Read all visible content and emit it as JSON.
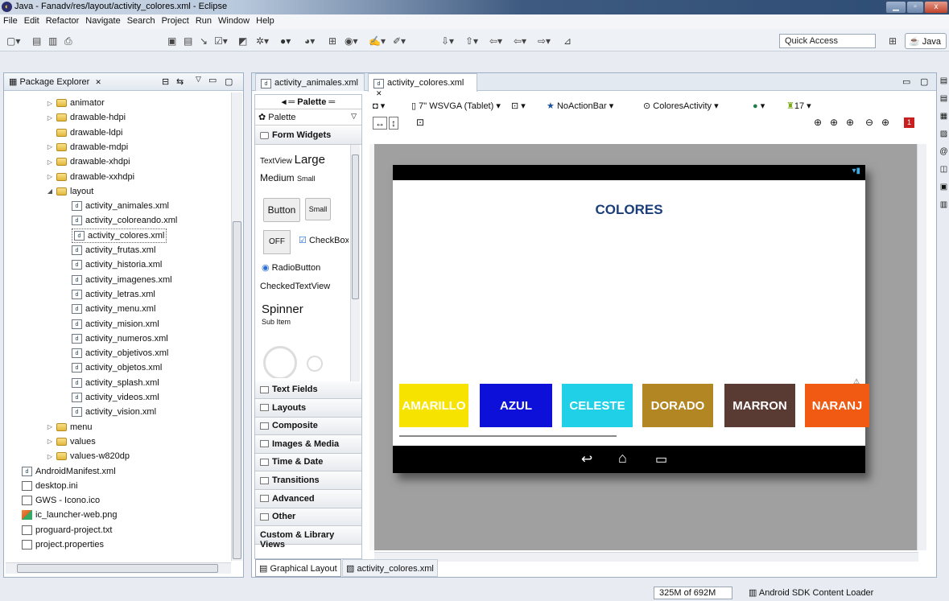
{
  "window": {
    "title": "Java - Fanadv/res/layout/activity_colores.xml - Eclipse"
  },
  "menu": [
    "File",
    "Edit",
    "Refactor",
    "Navigate",
    "Search",
    "Project",
    "Run",
    "Window",
    "Help"
  ],
  "toolbar": {
    "quick_access": "Quick Access",
    "perspective": "Java"
  },
  "package_explorer": {
    "tab_label": "Package Explorer",
    "items": [
      {
        "label": "animator",
        "type": "folder",
        "indent": 1,
        "twisty": "▷"
      },
      {
        "label": "drawable-hdpi",
        "type": "folder",
        "indent": 1,
        "twisty": "▷"
      },
      {
        "label": "drawable-ldpi",
        "type": "folder",
        "indent": 1,
        "twisty": ""
      },
      {
        "label": "drawable-mdpi",
        "type": "folder",
        "indent": 1,
        "twisty": "▷"
      },
      {
        "label": "drawable-xhdpi",
        "type": "folder",
        "indent": 1,
        "twisty": "▷"
      },
      {
        "label": "drawable-xxhdpi",
        "type": "folder",
        "indent": 1,
        "twisty": "▷"
      },
      {
        "label": "layout",
        "type": "folder",
        "indent": 1,
        "twisty": "◢"
      },
      {
        "label": "activity_animales.xml",
        "type": "xml",
        "indent": 2
      },
      {
        "label": "activity_coloreando.xml",
        "type": "xml",
        "indent": 2
      },
      {
        "label": "activity_colores.xml",
        "type": "xml",
        "indent": 2,
        "selected": true
      },
      {
        "label": "activity_frutas.xml",
        "type": "xml",
        "indent": 2
      },
      {
        "label": "activity_historia.xml",
        "type": "xml",
        "indent": 2
      },
      {
        "label": "activity_imagenes.xml",
        "type": "xml",
        "indent": 2
      },
      {
        "label": "activity_letras.xml",
        "type": "xml",
        "indent": 2
      },
      {
        "label": "activity_menu.xml",
        "type": "xml",
        "indent": 2
      },
      {
        "label": "activity_mision.xml",
        "type": "xml",
        "indent": 2
      },
      {
        "label": "activity_numeros.xml",
        "type": "xml",
        "indent": 2
      },
      {
        "label": "activity_objetivos.xml",
        "type": "xml",
        "indent": 2
      },
      {
        "label": "activity_objetos.xml",
        "type": "xml",
        "indent": 2
      },
      {
        "label": "activity_splash.xml",
        "type": "xml",
        "indent": 2
      },
      {
        "label": "activity_videos.xml",
        "type": "xml",
        "indent": 2
      },
      {
        "label": "activity_vision.xml",
        "type": "xml",
        "indent": 2
      },
      {
        "label": "menu",
        "type": "folder",
        "indent": 1,
        "twisty": "▷"
      },
      {
        "label": "values",
        "type": "folder",
        "indent": 1,
        "twisty": "▷"
      },
      {
        "label": "values-w820dp",
        "type": "folder",
        "indent": 1,
        "twisty": "▷"
      },
      {
        "label": "AndroidManifest.xml",
        "type": "xml",
        "indent": 0
      },
      {
        "label": "desktop.ini",
        "type": "file",
        "indent": 0
      },
      {
        "label": "GWS - Icono.ico",
        "type": "file",
        "indent": 0
      },
      {
        "label": "ic_launcher-web.png",
        "type": "image",
        "indent": 0
      },
      {
        "label": "proguard-project.txt",
        "type": "file",
        "indent": 0
      },
      {
        "label": "project.properties",
        "type": "file",
        "indent": 0
      }
    ]
  },
  "editor": {
    "tabs": [
      "activity_animales.xml",
      "activity_colores.xml"
    ],
    "active_tab": 1,
    "bottom_tabs": [
      "Graphical Layout",
      "activity_colores.xml"
    ],
    "config": {
      "device": "7\" WSVGA (Tablet)",
      "theme": "NoActionBar",
      "activity": "ColoresActivity",
      "api": "17"
    }
  },
  "palette": {
    "header": "Palette",
    "dropdown": "Palette",
    "section_open": "Form Widgets",
    "widgets": {
      "textview": "TextView",
      "large": "Large",
      "medium": "Medium",
      "small": "Small",
      "button": "Button",
      "button_small": "Small",
      "toggle_off": "OFF",
      "checkbox": "CheckBox",
      "radio": "RadioButton",
      "checked_text": "CheckedTextView",
      "spinner": "Spinner",
      "sub_item": "Sub Item"
    },
    "categories": [
      "Text Fields",
      "Layouts",
      "Composite",
      "Images & Media",
      "Time & Date",
      "Transitions",
      "Advanced",
      "Other",
      "Custom & Library Views"
    ]
  },
  "device_screen": {
    "title": "COLORES",
    "title_color": "#1a3e78",
    "buttons": [
      {
        "label": "AMARILLO",
        "color": "#f7e300"
      },
      {
        "label": "AZUL",
        "color": "#0c10d8"
      },
      {
        "label": "CELESTE",
        "color": "#1fd0e6"
      },
      {
        "label": "DORADO",
        "color": "#b38624"
      },
      {
        "label": "MARRON",
        "color": "#5a3b34"
      },
      {
        "label": "NARANJ",
        "color": "#f15a12"
      }
    ]
  },
  "status": {
    "memory": "325M of 692M",
    "loader": "Android SDK Content Loader"
  }
}
